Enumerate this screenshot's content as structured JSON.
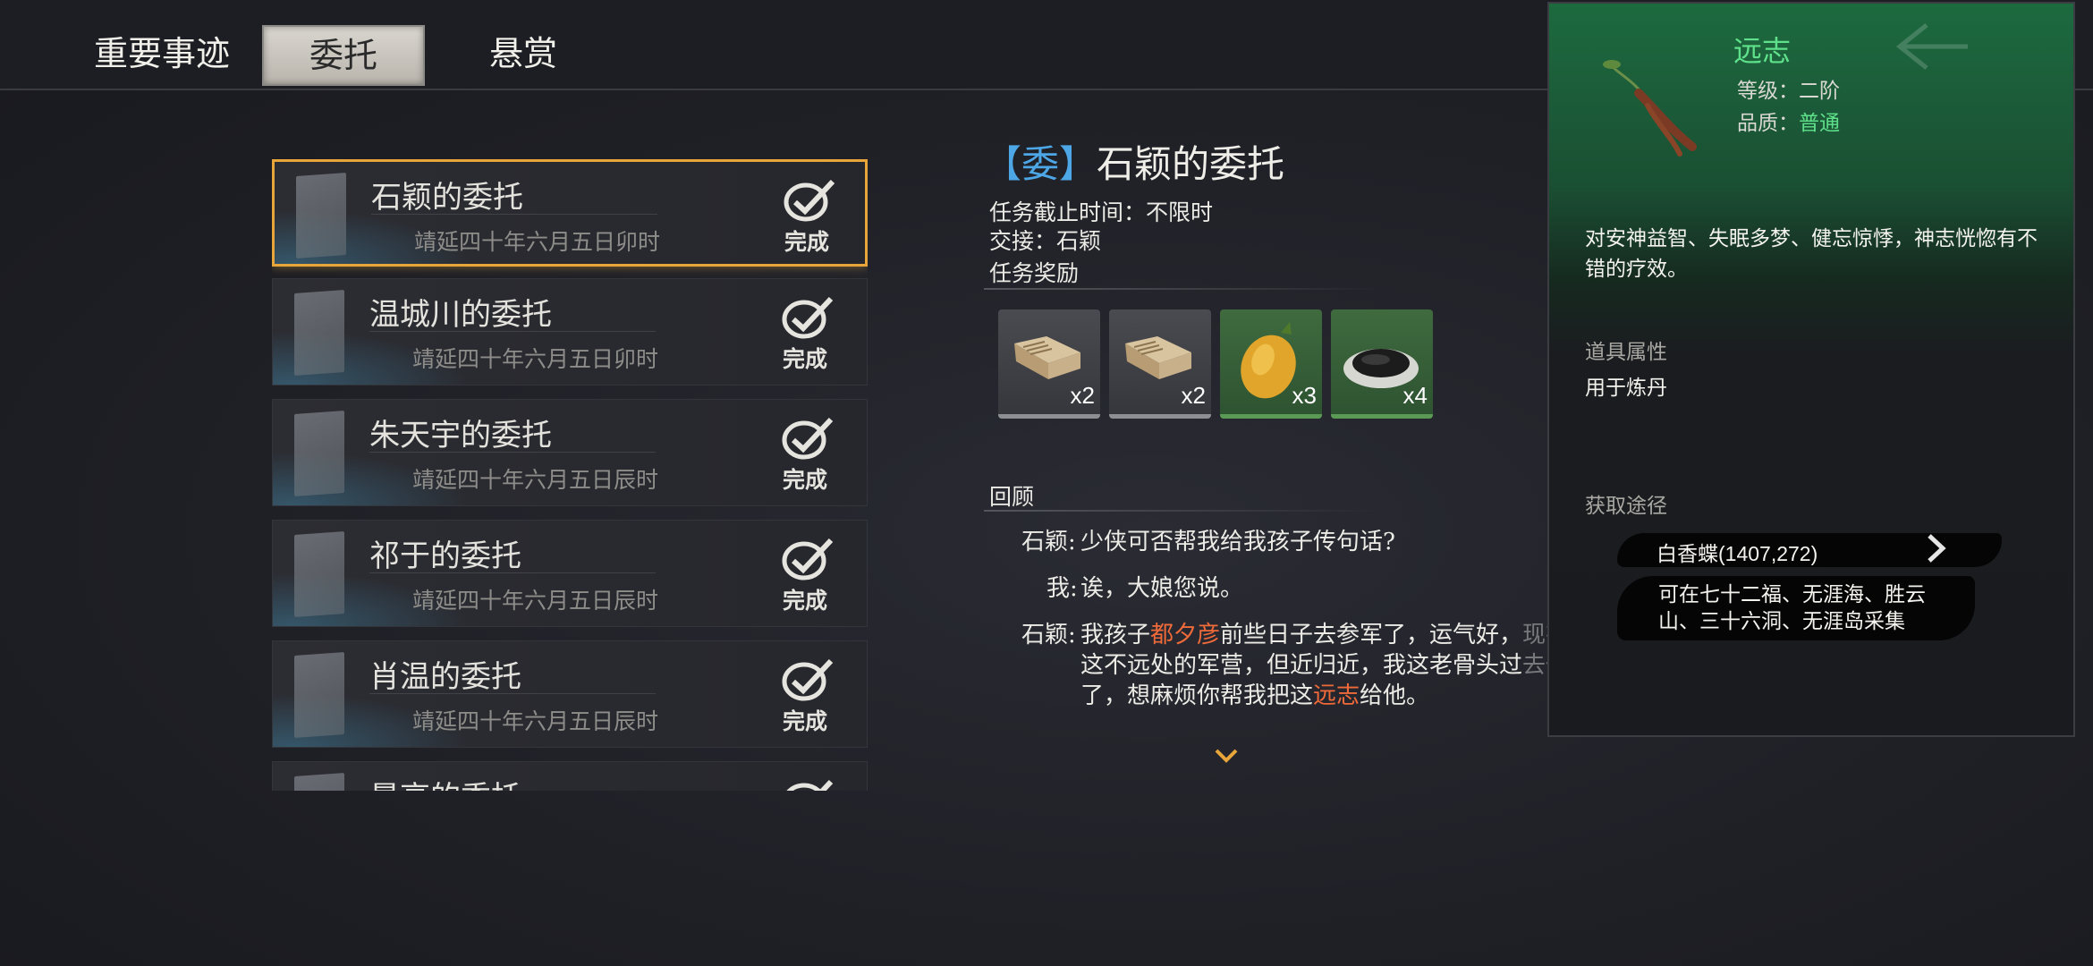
{
  "tabs": [
    "重要事迹",
    "委托",
    "悬赏"
  ],
  "active_tab": "委托",
  "quests": [
    {
      "title": "石颖的委托",
      "date": "靖延四十年六月五日卯时",
      "status": "完成"
    },
    {
      "title": "温城川的委托",
      "date": "靖延四十年六月五日卯时",
      "status": "完成"
    },
    {
      "title": "朱天宇的委托",
      "date": "靖延四十年六月五日辰时",
      "status": "完成"
    },
    {
      "title": "祁于的委托",
      "date": "靖延四十年六月五日辰时",
      "status": "完成"
    },
    {
      "title": "肖温的委托",
      "date": "靖延四十年六月五日辰时",
      "status": "完成"
    },
    {
      "title": "景高的委托",
      "date": "",
      "status": ""
    }
  ],
  "detail": {
    "tag": "委",
    "bracket_left": "【",
    "bracket_right": "】",
    "title": "石颖的委托",
    "deadline": "任务截止时间：不限时",
    "giver": "交接：石颖",
    "reward_header": "任务奖励",
    "rewards": [
      {
        "icon": "book-icon",
        "qty": "x2"
      },
      {
        "icon": "book-icon",
        "qty": "x2"
      },
      {
        "icon": "fruit-icon",
        "qty": "x3"
      },
      {
        "icon": "herb-dish-icon",
        "qty": "x4"
      }
    ],
    "review_header": "回顾",
    "dialogue": {
      "l1_speaker": "石颖:",
      "l1_text": "少侠可否帮我给我孩子传句话?",
      "l2_speaker": "我:",
      "l2_text": "诶，大娘您说。",
      "l3_speaker": "石颖:",
      "l3_a": "我孩子",
      "l3_name": "都夕彦",
      "l3_b": "前些日子去参军了，运气好，",
      "l3_fade1": "现在就在离",
      "l4_a": "这不远处的军营，但近归近，我这老骨头过",
      "l4_fade": "去也不方便",
      "l5_a": "了，想麻烦你帮我把这",
      "l5_item": "远志",
      "l5_b": "给他。"
    }
  },
  "tooltip": {
    "name": "远志",
    "level": "等级：二阶",
    "quality_label": "品质：",
    "quality": "普通",
    "description": "对安神益智、失眠多梦、健忘惊悸，神志恍惚有不错的疗效。",
    "attr_header": "道具属性",
    "attr_value": "用于炼丹",
    "source_header": "获取途径",
    "source1": "白香蝶(1407,272)",
    "source2": "可在七十二福、无涯海、胜云山、三十六洞、无涯岛采集"
  },
  "colors": {
    "accent_gold": "#e8a53a",
    "tag_blue": "#4da6e6",
    "highlight_orange": "#f06a3a",
    "quality_green": "#5fe08a"
  }
}
